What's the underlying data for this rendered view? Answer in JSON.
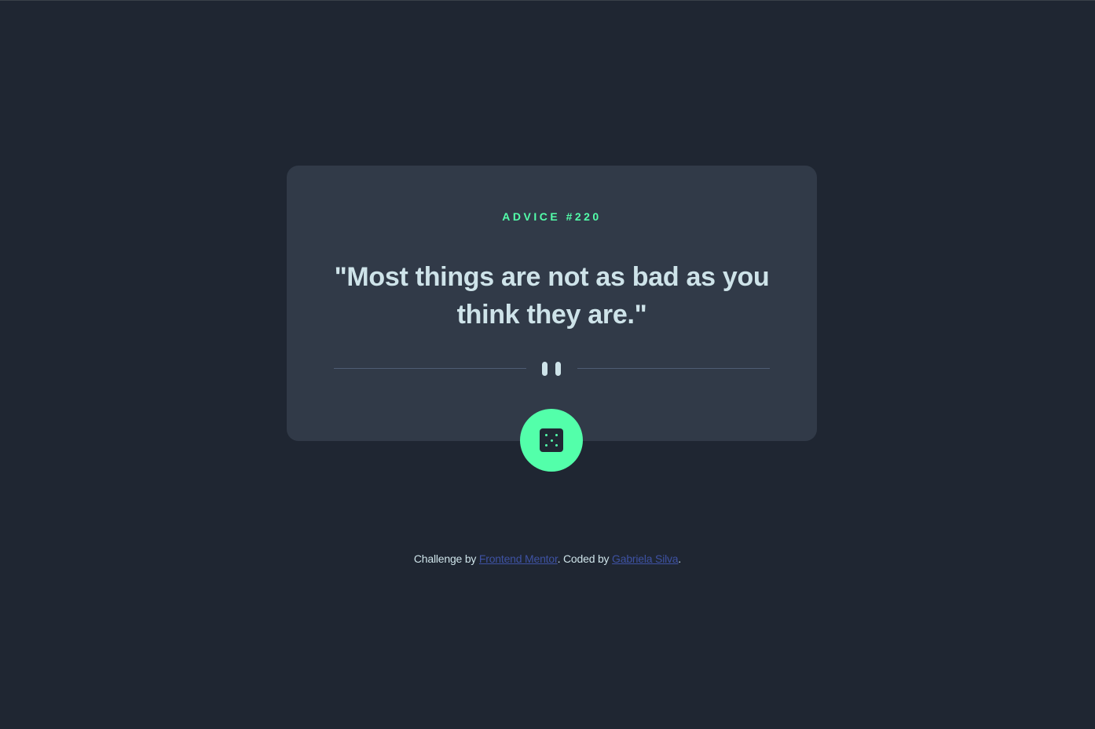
{
  "advice": {
    "label": "ADVICE #220",
    "quote": "\"Most things are not as bad as you think they are.\""
  },
  "dice_button": {
    "icon": "dice-icon"
  },
  "divider": {
    "icon": "pause-icon"
  },
  "footer": {
    "prefix": "Challenge by ",
    "link1": "Frontend Mentor",
    "middle": ". Coded by ",
    "link2": "Gabriela Silva",
    "suffix": "."
  },
  "colors": {
    "background": "#1f2632",
    "card": "#313a48",
    "accent": "#53ffaa",
    "text": "#cee3e9",
    "link": "#3e52a3"
  }
}
